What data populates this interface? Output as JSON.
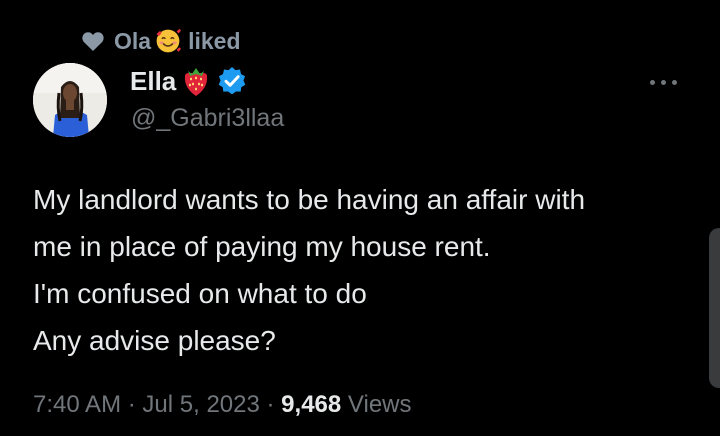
{
  "social_context": {
    "name": "Ola",
    "action": "liked",
    "icon": "heart-icon",
    "emoji": "smiling-face-with-hearts-emoji"
  },
  "author": {
    "display_name": "Ella",
    "emoji": "strawberry-emoji",
    "verified": true,
    "handle": "@_Gabri3llaa"
  },
  "tweet": {
    "lines": [
      "My landlord wants to be having an affair with",
      "me in place of paying my house rent.",
      "I'm confused on what to do",
      "Any advise please?"
    ]
  },
  "meta": {
    "time": "7:40 AM",
    "separator": "·",
    "date": "Jul 5, 2023",
    "views_count": "9,468",
    "views_label": "Views"
  },
  "colors": {
    "background": "#000000",
    "primary_text": "#e7e9ea",
    "secondary_text": "#71767b",
    "verified_blue": "#1d9bf0"
  }
}
